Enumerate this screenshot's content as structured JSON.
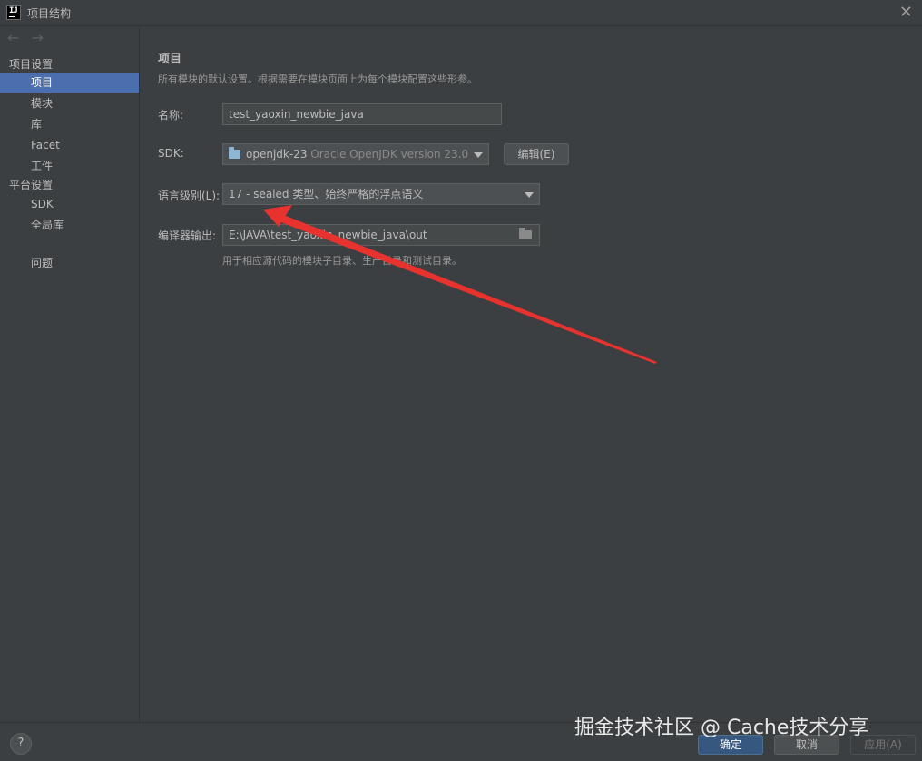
{
  "window": {
    "title": "项目结构",
    "close_symbol": "✕"
  },
  "nav": {
    "back": "←",
    "forward": "→"
  },
  "sidebar": {
    "section_project": "项目设置",
    "project_items": [
      {
        "label": "项目",
        "selected": true
      },
      {
        "label": "模块"
      },
      {
        "label": "库"
      },
      {
        "label": "Facet"
      },
      {
        "label": "工件"
      }
    ],
    "section_platform": "平台设置",
    "platform_items": [
      {
        "label": "SDK"
      },
      {
        "label": "全局库"
      }
    ],
    "problems": "问题"
  },
  "main": {
    "heading": "项目",
    "description": "所有模块的默认设置。根据需要在模块页面上为每个模块配置这些形参。",
    "name_label": "名称:",
    "name_value": "test_yaoxin_newbie_java",
    "sdk_label": "SDK:",
    "sdk_value": "openjdk-23",
    "sdk_detail": "Oracle OpenJDK version 23.0",
    "edit_button": "编辑(E)",
    "language_label": "语言级别(L):",
    "language_value": "17 - sealed 类型、始终严格的浮点语义",
    "output_label": "编译器输出:",
    "output_value": "E:\\JAVA\\test_yaoxin_newbie_java\\out",
    "output_hint": "用于相应源代码的模块子目录、生产目录和测试目录。"
  },
  "footer": {
    "help": "?",
    "ok": "确定",
    "cancel": "取消",
    "apply": "应用(A)"
  },
  "watermark": "掘金技术社区 @ Cache技术分享",
  "colors": {
    "background": "#3c3f41",
    "selection": "#4b6eaf",
    "ok_button": "#365880",
    "annotation_arrow": "#e8322e"
  }
}
